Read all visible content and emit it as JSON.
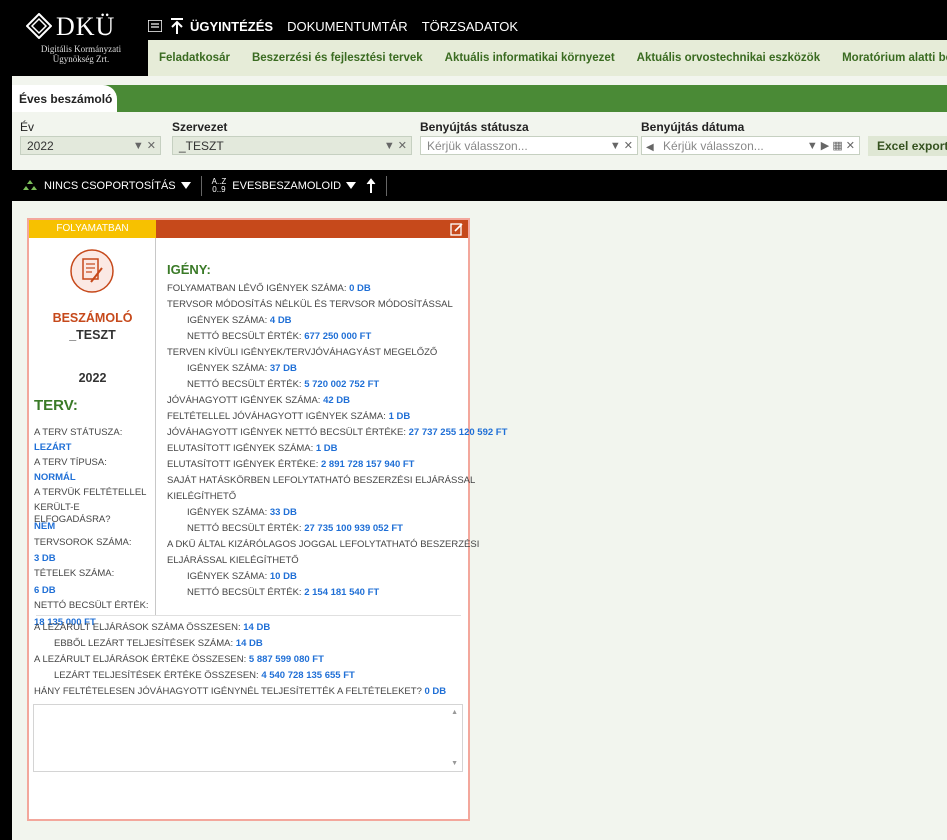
{
  "logo": {
    "text": "DKÜ",
    "sub_line1": "Digitális Kormányzati",
    "sub_line2": "Ügynökség Zrt."
  },
  "top_nav": {
    "items": [
      "ÜGYINTÉZÉS",
      "DOKUMENTUMTÁR",
      "TÖRZSADATOK"
    ],
    "active": "ÜGYINTÉZÉS"
  },
  "sub_nav": {
    "items": [
      "Feladatkosár",
      "Beszerzési és fejlesztési tervek",
      "Aktuális informatikai környezet",
      "Aktuális orvostechnikai eszközök",
      "Moratórium alatti beszerzés"
    ]
  },
  "tab": {
    "label": "Éves beszámoló"
  },
  "filters": {
    "ev": {
      "label": "Év",
      "value": "2022"
    },
    "szervezet": {
      "label": "Szervezet",
      "value": "_TESZT"
    },
    "status": {
      "label": "Benyújtás státusza",
      "placeholder": "Kérjük válasszon..."
    },
    "date": {
      "label": "Benyújtás dátuma",
      "placeholder": "Kérjük válasszon..."
    },
    "excel_label": "Excel export"
  },
  "groupbar": {
    "grouping": "NINCS CSOPORTOSÍTÁS",
    "sort_glyph_top": "A..Z",
    "sort_glyph_bottom": "0..9",
    "sort_field": "EVESBESZAMOLOID"
  },
  "card": {
    "status": "FOLYAMATBAN",
    "type": "BESZÁMOLÓ",
    "org": "_TESZT",
    "year": "2022",
    "terv": {
      "title": "TERV:",
      "status_label": "A TERV STÁTUSZA:",
      "status_value": "LEZÁRT",
      "type_label": "A TERV TÍPUSA:",
      "type_value": "NORMÁL",
      "cond_label_1": "A TERVÜK FELTÉTELLEL",
      "cond_label_2": "KERÜLT-E ELFOGADÁSRA?",
      "cond_value": "NEM",
      "rows_label": "TERVSOROK SZÁMA:",
      "rows_value": "3 DB",
      "items_label": "TÉTELEK SZÁMA:",
      "items_value": "6 DB",
      "net_label": "NETTÓ BECSÜLT ÉRTÉK:",
      "net_value": "18 135 000 FT"
    },
    "igeny": {
      "title": "IGÉNY:",
      "lines": [
        {
          "indent": false,
          "label": "FOLYAMATBAN LÉVŐ IGÉNYEK SZÁMA: ",
          "value": "0 DB"
        },
        {
          "indent": false,
          "label": "TERVSOR MÓDOSÍTÁS NÉLKÜL ÉS TERVSOR MÓDOSÍTÁSSAL",
          "value": ""
        },
        {
          "indent": true,
          "label": "IGÉNYEK SZÁMA: ",
          "value": "4 DB"
        },
        {
          "indent": true,
          "label": "NETTÓ BECSÜLT ÉRTÉK: ",
          "value": "677 250 000 FT"
        },
        {
          "indent": false,
          "label": "TERVEN KÍVÜLI IGÉNYEK/TERVJÓVÁHAGYÁST MEGELŐZŐ",
          "value": ""
        },
        {
          "indent": true,
          "label": "IGÉNYEK SZÁMA: ",
          "value": "37 DB"
        },
        {
          "indent": true,
          "label": "NETTÓ BECSÜLT ÉRTÉK: ",
          "value": "5 720 002 752 FT"
        },
        {
          "indent": false,
          "label": "JÓVÁHAGYOTT IGÉNYEK SZÁMA: ",
          "value": "42 DB"
        },
        {
          "indent": false,
          "label": "FELTÉTELLEL JÓVÁHAGYOTT IGÉNYEK SZÁMA: ",
          "value": "1 DB"
        },
        {
          "indent": false,
          "label": "JÓVÁHAGYOTT IGÉNYEK NETTÓ BECSÜLT ÉRTÉKE: ",
          "value": "27 737 255 120 592 FT"
        },
        {
          "indent": false,
          "label": "ELUTASÍTOTT IGÉNYEK SZÁMA: ",
          "value": "1 DB"
        },
        {
          "indent": false,
          "label": "ELUTASÍTOTT IGÉNYEK ÉRTÉKE: ",
          "value": "2 891 728 157 940 FT"
        },
        {
          "indent": false,
          "label": "SAJÁT HATÁSKÖRBEN LEFOLYTATHATÓ BESZERZÉSI ELJÁRÁSSAL",
          "value": ""
        },
        {
          "indent": false,
          "label": "KIELÉGÍTHETŐ",
          "value": ""
        },
        {
          "indent": true,
          "label": "IGÉNYEK SZÁMA: ",
          "value": "33 DB"
        },
        {
          "indent": true,
          "label": "NETTÓ BECSÜLT ÉRTÉK: ",
          "value": "27 735 100 939 052 FT"
        },
        {
          "indent": false,
          "label": "A DKÜ ÁLTAL KIZÁRÓLAGOS JOGGAL LEFOLYTATHATÓ BESZERZÉSI",
          "value": ""
        },
        {
          "indent": false,
          "label": "ELJÁRÁSSAL KIELÉGÍTHETŐ",
          "value": ""
        },
        {
          "indent": true,
          "label": "IGÉNYEK SZÁMA: ",
          "value": "10 DB"
        },
        {
          "indent": true,
          "label": "NETTÓ BECSÜLT ÉRTÉK: ",
          "value": "2 154 181 540 FT"
        }
      ]
    },
    "bottom": [
      {
        "indent": false,
        "label": "A LEZÁRULT ELJÁRÁSOK SZÁMA ÖSSZESEN: ",
        "value": "14 DB"
      },
      {
        "indent": true,
        "label": "EBBŐL LEZÁRT TELJESÍTÉSEK SZÁMA: ",
        "value": "14 DB"
      },
      {
        "indent": false,
        "label": "A LEZÁRULT ELJÁRÁSOK ÉRTÉKE ÖSSZESEN: ",
        "value": "5 887 599 080 FT"
      },
      {
        "indent": true,
        "label": "LEZÁRT TELJESÍTÉSEK ÉRTÉKE ÖSSZESEN: ",
        "value": "4 540 728 135 655 FT"
      },
      {
        "indent": false,
        "label": "HÁNY FELTÉTELESEN JÓVÁHAGYOTT IGÉNYNÉL TELJESÍTETTÉK A FELTÉTELEKET? ",
        "value": "0 DB"
      }
    ]
  },
  "colors": {
    "green": "#4a8a36",
    "status_yellow": "#f7c100",
    "status_red": "#c6491b",
    "link_blue": "#1f6fd6"
  }
}
